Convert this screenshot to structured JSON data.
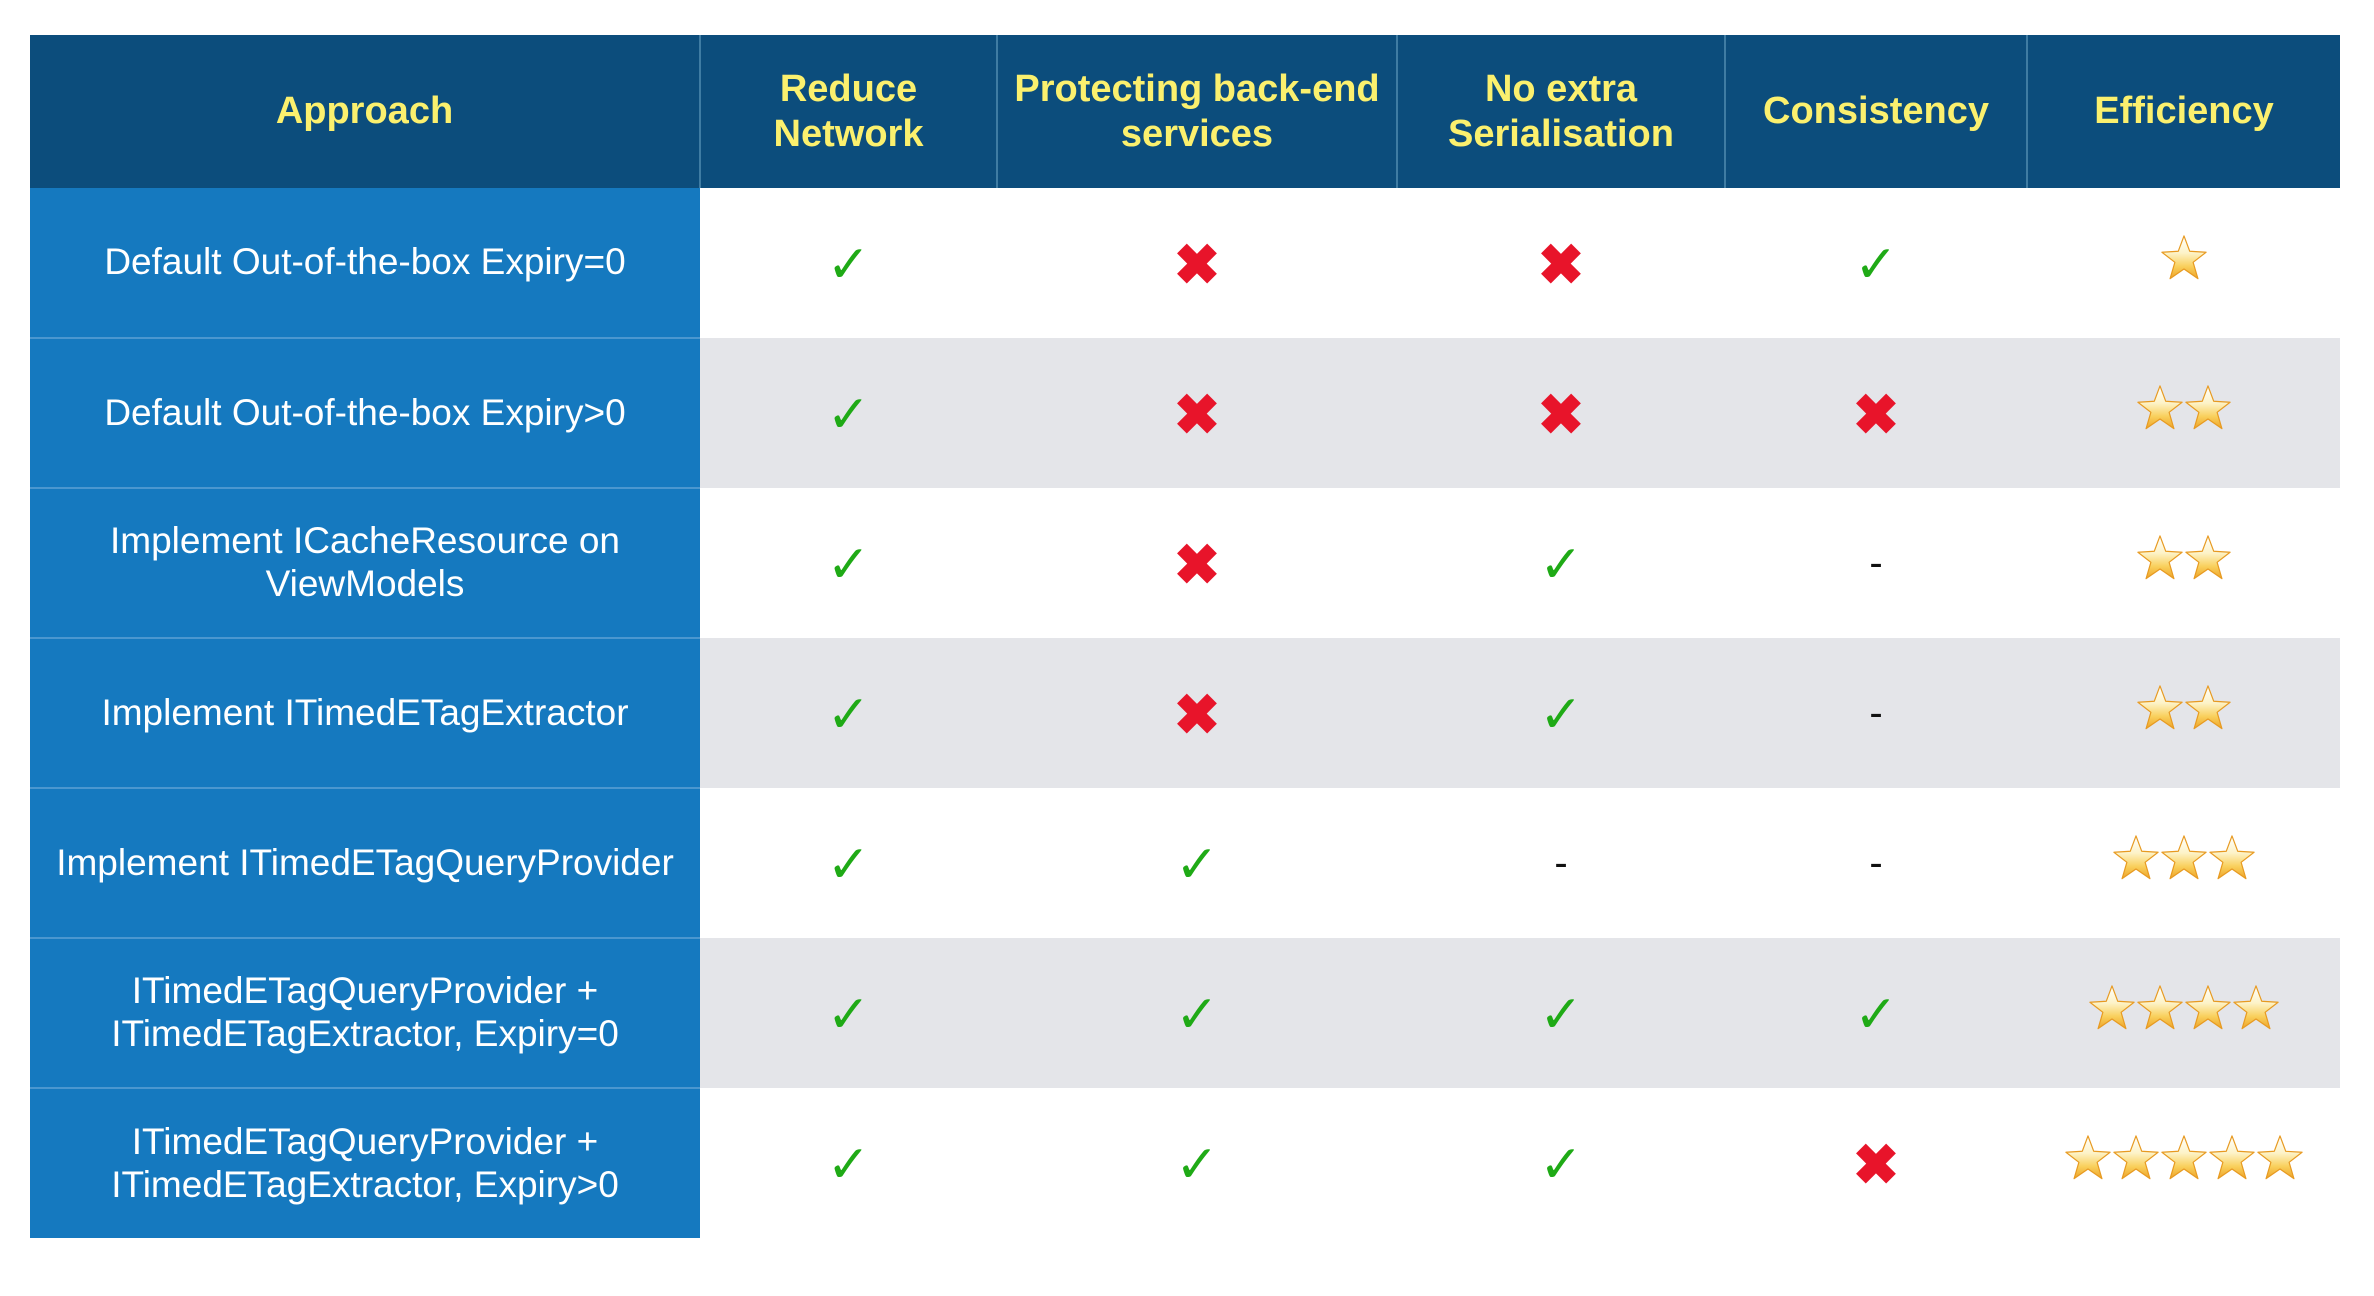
{
  "table": {
    "columns": [
      {
        "key": "approach",
        "label": "Approach"
      },
      {
        "key": "reduce",
        "label": "Reduce Network"
      },
      {
        "key": "protect",
        "label": "Protecting back-end services"
      },
      {
        "key": "noextra",
        "label": "No extra Serialisation"
      },
      {
        "key": "consistency",
        "label": "Consistency"
      },
      {
        "key": "efficiency",
        "label": "Efficiency"
      }
    ],
    "rows": [
      {
        "approach": "Default Out-of-the-box Expiry=0",
        "reduce": "check",
        "protect": "cross",
        "noextra": "cross",
        "consistency": "check",
        "efficiency": 1
      },
      {
        "approach": "Default Out-of-the-box Expiry>0",
        "reduce": "check",
        "protect": "cross",
        "noextra": "cross",
        "consistency": "cross",
        "efficiency": 2
      },
      {
        "approach": "Implement ICacheResource on ViewModels",
        "reduce": "check",
        "protect": "cross",
        "noextra": "check",
        "consistency": "dash",
        "efficiency": 2
      },
      {
        "approach": "Implement ITimedETagExtractor",
        "reduce": "check",
        "protect": "cross",
        "noextra": "check",
        "consistency": "dash",
        "efficiency": 2
      },
      {
        "approach": "Implement ITimedETagQueryProvider",
        "reduce": "check",
        "protect": "check",
        "noextra": "dash",
        "consistency": "dash",
        "efficiency": 3
      },
      {
        "approach": "ITimedETagQueryProvider + ITimedETagExtractor, Expiry=0",
        "reduce": "check",
        "protect": "check",
        "noextra": "check",
        "consistency": "check",
        "efficiency": 4
      },
      {
        "approach": "ITimedETagQueryProvider + ITimedETagExtractor, Expiry>0",
        "reduce": "check",
        "protect": "check",
        "noextra": "check",
        "consistency": "cross",
        "efficiency": 5
      }
    ],
    "marks": {
      "check": "✓",
      "cross": "✖",
      "dash": "-"
    },
    "colors": {
      "header_background": "#0c4d7c",
      "header_text": "#fbf06e",
      "approach_column_background": "#1579bf",
      "approach_column_text": "#ffffff",
      "stripe_background": "#e4e5e9",
      "plain_background": "#ffffff",
      "check_color": "#1faa16",
      "cross_color": "#e8142a",
      "star_color": "#f6b73c"
    }
  }
}
